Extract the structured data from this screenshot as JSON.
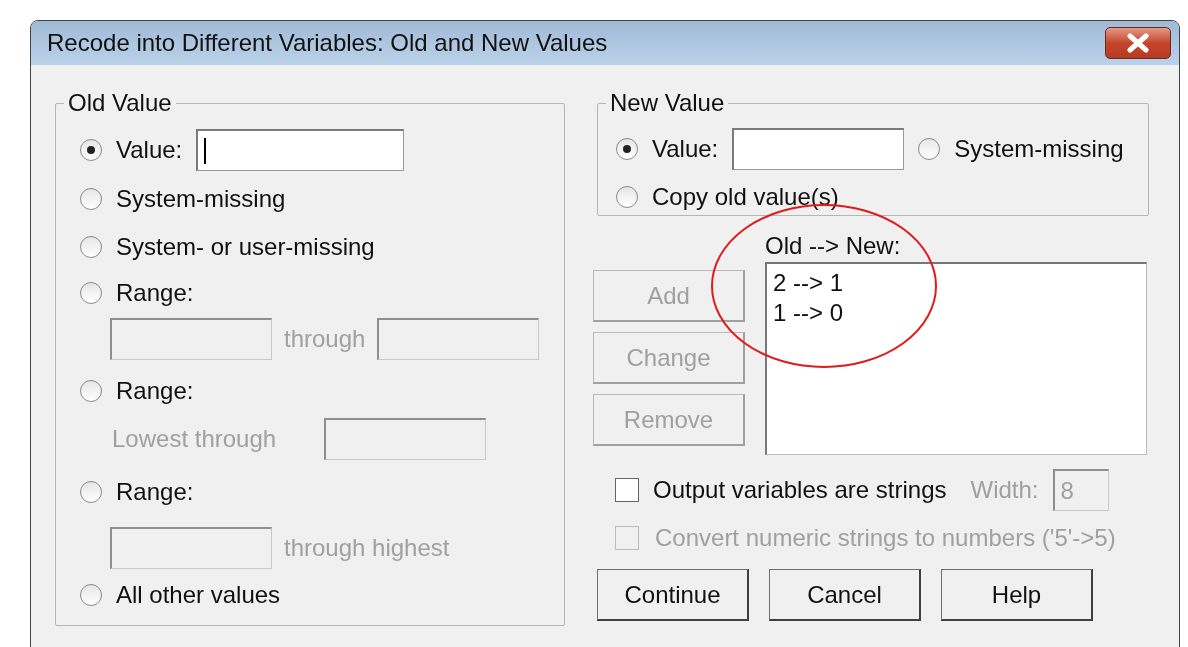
{
  "window": {
    "title": "Recode into Different Variables: Old and New Values"
  },
  "old_value": {
    "title": "Old Value",
    "options": [
      {
        "kind": "value",
        "label": "Value:",
        "selected": true,
        "field_focused": true
      },
      {
        "kind": "plain",
        "label": "System-missing",
        "selected": false
      },
      {
        "kind": "plain",
        "label": "System- or user-missing",
        "selected": false
      },
      {
        "kind": "between",
        "label": "Range:",
        "selected": false,
        "sublabel": "through",
        "disabled": true
      },
      {
        "kind": "lowest",
        "label": "Range:",
        "selected": false,
        "sublabel": "Lowest through",
        "disabled": true
      },
      {
        "kind": "highest",
        "label": "Range:",
        "selected": false,
        "sublabel": "through highest",
        "disabled": true
      },
      {
        "kind": "plain",
        "label": "All other values",
        "selected": false
      }
    ]
  },
  "new_value": {
    "title": "New Value",
    "options": [
      {
        "label": "Value:",
        "selected": true
      },
      {
        "label": "System-missing",
        "selected": false
      },
      {
        "label": "Copy old value(s)",
        "selected": false
      }
    ]
  },
  "mapping": {
    "label": "Old --> New:",
    "items": [
      "2 --> 1",
      "1 --> 0"
    ],
    "annotated": true
  },
  "action_buttons": [
    {
      "label": "Add",
      "disabled": true
    },
    {
      "label": "Change",
      "disabled": true
    },
    {
      "label": "Remove",
      "disabled": true
    }
  ],
  "output_strings": {
    "label": "Output variables are strings",
    "checked": false
  },
  "width": {
    "label": "Width:",
    "value": "8",
    "disabled": true
  },
  "convert": {
    "label": "Convert numeric strings to numbers ('5'->5)",
    "checked": false,
    "disabled": true
  },
  "footer_buttons": [
    {
      "label": "Continue",
      "disabled": false
    },
    {
      "label": "Cancel",
      "disabled": false
    },
    {
      "label": "Help",
      "disabled": false
    }
  ]
}
